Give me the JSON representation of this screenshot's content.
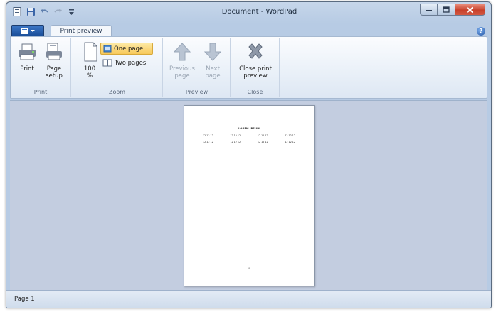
{
  "window": {
    "title": "Document - WordPad",
    "controls": {
      "minimize_icon": "minimize-icon",
      "maximize_icon": "maximize-icon",
      "close_icon": "close-icon"
    }
  },
  "quick_access": [
    "wordpad-app-icon",
    "save-icon",
    "undo-icon",
    "redo-icon",
    "customize-toolbar-icon"
  ],
  "tabs": {
    "active": "Print preview"
  },
  "ribbon": {
    "print_group": {
      "label": "Print",
      "print_label": "Print",
      "page_setup_line1": "Page",
      "page_setup_line2": "setup"
    },
    "zoom_group": {
      "label": "Zoom",
      "zoom_line1": "100",
      "zoom_line2": "%",
      "one_page": "One page",
      "two_pages": "Two pages",
      "selected": "One page"
    },
    "preview_group": {
      "label": "Preview",
      "previous_line1": "Previous",
      "previous_line2": "page",
      "next_line1": "Next",
      "next_line2": "page"
    },
    "close_group": {
      "label": "Close",
      "close_line1": "Close print",
      "close_line2": "preview"
    }
  },
  "document_preview": {
    "heading": "LOREM IPSUM",
    "rows": [
      [
        "12 12 12",
        "12 12 12",
        "12 12 12",
        "12 12 12"
      ],
      [
        "12 12 12",
        "12 12 12",
        "12 12 12",
        "12 12 12"
      ]
    ],
    "page_number": "1"
  },
  "status": {
    "page": "Page 1"
  },
  "colors": {
    "frame": "#b7cbe4",
    "preview_bg": "#c3cde0",
    "selected": "#f7c85a",
    "app_button": "#2a5fae",
    "close_button": "#c7402a"
  }
}
